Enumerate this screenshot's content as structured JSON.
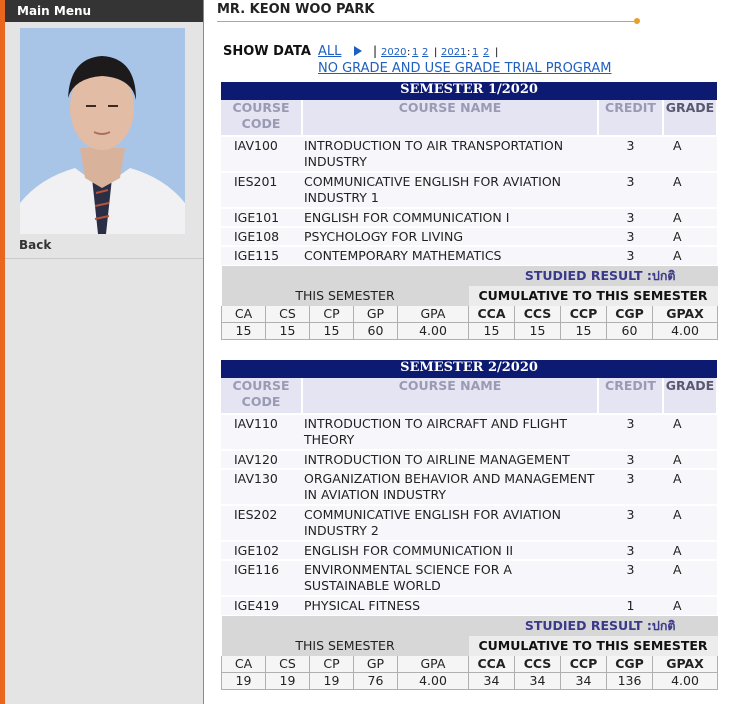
{
  "sidebar": {
    "menu_title": "Main Menu",
    "back_label": "Back"
  },
  "student_name": "MR. KEON WOO PARK",
  "show_data": {
    "label": "SHOW DATA",
    "all_link": "ALL",
    "pipe": "|",
    "years": [
      {
        "year": "2020",
        "sem1": "1",
        "sem2": "2"
      },
      {
        "year": "2021",
        "sem1": "1",
        "sem2": "2"
      }
    ],
    "no_grade_link": "NO GRADE AND USE GRADE TRIAL PROGRAM"
  },
  "headers": {
    "code": "COURSE CODE",
    "name": "COURSE NAME",
    "credit": "CREDIT",
    "grade": "GRADE"
  },
  "summary_labels": {
    "studied_result": "STUDIED RESULT :ปกติ",
    "this_semester": "THIS SEMESTER",
    "cumulative": "CUMULATIVE TO THIS SEMESTER",
    "ca": "CA",
    "cs": "CS",
    "cp": "CP",
    "gp": "GP",
    "gpa": "GPA",
    "cca": "CCA",
    "ccs": "CCS",
    "ccp": "CCP",
    "cgp": "CGP",
    "gpax": "GPAX"
  },
  "semesters": [
    {
      "title": "SEMESTER 1/2020",
      "courses": [
        {
          "code": "IAV100",
          "name": "INTRODUCTION TO AIR TRANSPORTATION INDUSTRY",
          "credit": "3",
          "grade": "A"
        },
        {
          "code": "IES201",
          "name": "COMMUNICATIVE ENGLISH FOR AVIATION INDUSTRY 1",
          "credit": "3",
          "grade": "A"
        },
        {
          "code": "IGE101",
          "name": "ENGLISH FOR COMMUNICATION I",
          "credit": "3",
          "grade": "A"
        },
        {
          "code": "IGE108",
          "name": "PSYCHOLOGY FOR LIVING",
          "credit": "3",
          "grade": "A"
        },
        {
          "code": "IGE115",
          "name": "CONTEMPORARY MATHEMATICS",
          "credit": "3",
          "grade": "A"
        }
      ],
      "summary": {
        "ca": "15",
        "cs": "15",
        "cp": "15",
        "gp": "60",
        "gpa": "4.00",
        "cca": "15",
        "ccs": "15",
        "ccp": "15",
        "cgp": "60",
        "gpax": "4.00"
      }
    },
    {
      "title": "SEMESTER 2/2020",
      "courses": [
        {
          "code": "IAV110",
          "name": "INTRODUCTION TO AIRCRAFT AND FLIGHT THEORY",
          "credit": "3",
          "grade": "A"
        },
        {
          "code": "IAV120",
          "name": "INTRODUCTION TO AIRLINE MANAGEMENT",
          "credit": "3",
          "grade": "A"
        },
        {
          "code": "IAV130",
          "name": "ORGANIZATION BEHAVIOR AND MANAGEMENT IN AVIATION INDUSTRY",
          "credit": "3",
          "grade": "A"
        },
        {
          "code": "IES202",
          "name": "COMMUNICATIVE ENGLISH FOR AVIATION INDUSTRY 2",
          "credit": "3",
          "grade": "A"
        },
        {
          "code": "IGE102",
          "name": "ENGLISH FOR COMMUNICATION II",
          "credit": "3",
          "grade": "A"
        },
        {
          "code": "IGE116",
          "name": "ENVIRONMENTAL SCIENCE FOR A SUSTAINABLE WORLD",
          "credit": "3",
          "grade": "A"
        },
        {
          "code": "IGE419",
          "name": "PHYSICAL FITNESS",
          "credit": "1",
          "grade": "A"
        }
      ],
      "summary": {
        "ca": "19",
        "cs": "19",
        "cp": "19",
        "gp": "76",
        "gpa": "4.00",
        "cca": "34",
        "ccs": "34",
        "ccp": "34",
        "cgp": "136",
        "gpax": "4.00"
      }
    }
  ]
}
